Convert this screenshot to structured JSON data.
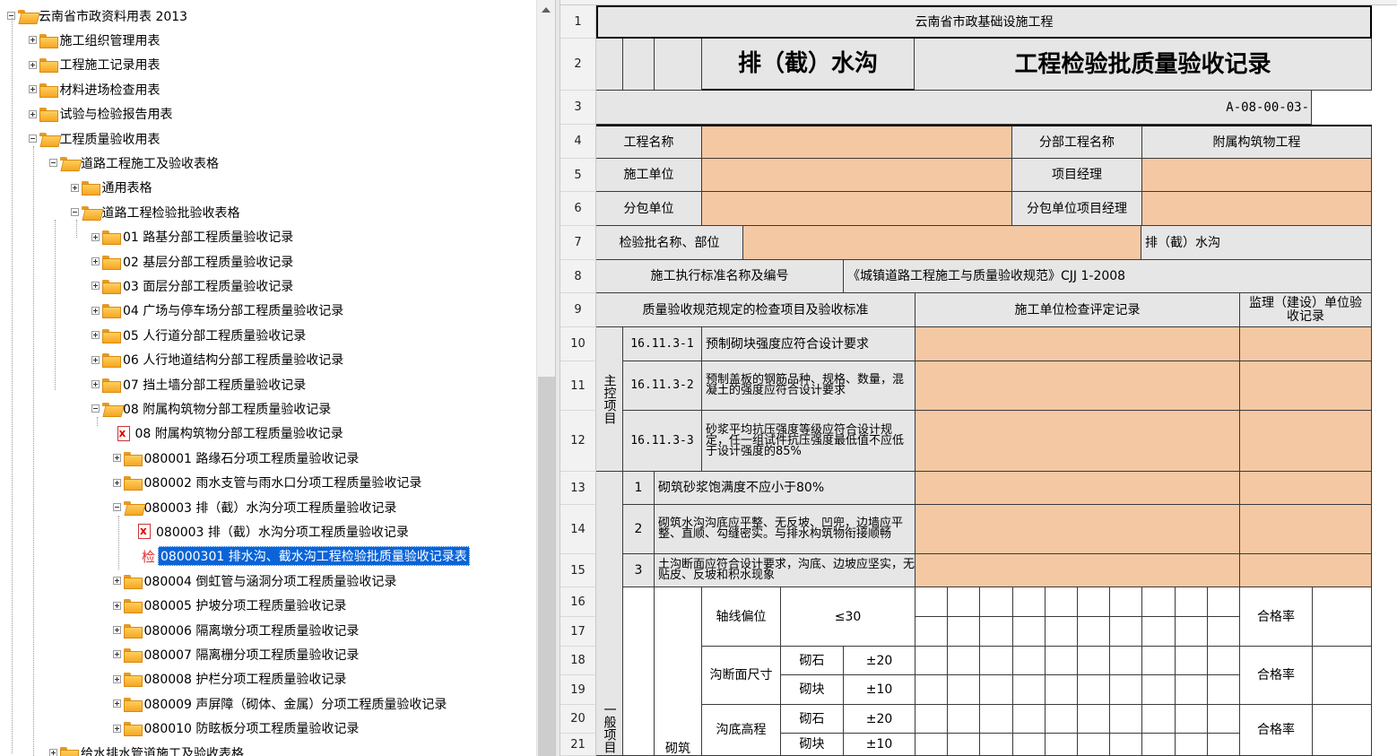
{
  "tree": {
    "items": [
      {
        "label": "云南省市政资料用表 2013",
        "level": 0,
        "node": "open"
      },
      {
        "label": "施工组织管理用表",
        "level": 1,
        "node": "closed"
      },
      {
        "label": "工程施工记录用表",
        "level": 1,
        "node": "closed"
      },
      {
        "label": "材料进场检查用表",
        "level": 1,
        "node": "closed"
      },
      {
        "label": "试验与检验报告用表",
        "level": 1,
        "node": "closed"
      },
      {
        "label": "工程质量验收用表",
        "level": 1,
        "node": "open"
      },
      {
        "label": "道路工程施工及验收表格",
        "level": 2,
        "node": "open"
      },
      {
        "label": "通用表格",
        "level": 3,
        "node": "closed"
      },
      {
        "label": "道路工程检验批验收表格",
        "level": 3,
        "node": "open"
      },
      {
        "label": "01 路基分部工程质量验收记录",
        "level": 4,
        "node": "closed"
      },
      {
        "label": "02 基层分部工程质量验收记录",
        "level": 4,
        "node": "closed"
      },
      {
        "label": "03 面层分部工程质量验收记录",
        "level": 4,
        "node": "closed"
      },
      {
        "label": "04 广场与停车场分部工程质量验收记录",
        "level": 4,
        "node": "closed"
      },
      {
        "label": "05 人行道分部工程质量验收记录",
        "level": 4,
        "node": "closed"
      },
      {
        "label": "06 人行地道结构分部工程质量验收记录",
        "level": 4,
        "node": "closed"
      },
      {
        "label": "07 挡土墙分部工程质量验收记录",
        "level": 4,
        "node": "closed"
      },
      {
        "label": "08 附属构筑物分部工程质量验收记录",
        "level": 4,
        "node": "open"
      },
      {
        "label": "08 附属构筑物分部工程质量验收记录",
        "level": 5,
        "node": "pdf"
      },
      {
        "label": "080001 路缘石分项工程质量验收记录",
        "level": 5,
        "node": "closed"
      },
      {
        "label": "080002 雨水支管与雨水口分项工程质量验收记录",
        "level": 5,
        "node": "closed"
      },
      {
        "label": "080003 排（截）水沟分项工程质量验收记录",
        "level": 5,
        "node": "open"
      },
      {
        "label": "080003 排（截）水沟分项工程质量验收记录",
        "level": 6,
        "node": "pdf"
      },
      {
        "label": "08000301 排水沟、截水沟工程检验批质量验收记录表",
        "level": 6,
        "node": "sheet",
        "selected": true,
        "icon_text": "检"
      },
      {
        "label": "080004 倒虹管与涵洞分项工程质量验收记录",
        "level": 5,
        "node": "closed"
      },
      {
        "label": "080005 护坡分项工程质量验收记录",
        "level": 5,
        "node": "closed"
      },
      {
        "label": "080006 隔离墩分项工程质量验收记录",
        "level": 5,
        "node": "closed"
      },
      {
        "label": "080007 隔离栅分项工程质量验收记录",
        "level": 5,
        "node": "closed"
      },
      {
        "label": "080008 护栏分项工程质量验收记录",
        "level": 5,
        "node": "closed"
      },
      {
        "label": "080009 声屏障（砌体、金属）分项工程质量验收记录",
        "level": 5,
        "node": "closed"
      },
      {
        "label": "080010 防眩板分项工程质量验收记录",
        "level": 5,
        "node": "closed"
      },
      {
        "label": "给水排水管道施工及验收表格",
        "level": 2,
        "node": "closed"
      }
    ]
  },
  "sheet": {
    "row_numbers": [
      "1",
      "2",
      "3",
      "4",
      "5",
      "6",
      "7",
      "8",
      "9",
      "10",
      "11",
      "12",
      "13",
      "14",
      "15",
      "16",
      "17",
      "18",
      "19",
      "20",
      "21"
    ],
    "title_top": "云南省市政基础设施工程",
    "title_left": "排（截）水沟",
    "title_right": "工程检验批质量验收记录",
    "form_code": "A-08-00-03-",
    "project_name_label": "工程名称",
    "sub_project_label": "分部工程名称",
    "sub_project_value": "附属构筑物工程",
    "contractor_label": "施工单位",
    "project_manager_label": "项目经理",
    "subcontractor_label": "分包单位",
    "sub_pm_label": "分包单位项目经理",
    "batch_label": "检验批名称、部位",
    "batch_value": "排（截）水沟",
    "standard_label": "施工执行标准名称及编号",
    "standard_value": "《城镇道路工程施工与质量验收规范》CJJ 1-2008",
    "header_items": "质量验收规范规定的检查项目及验收标准",
    "header_contractor": "施工单位检查评定记录",
    "header_supervisor": "监理（建设）单位验收记录",
    "main_items_label": "主控项目",
    "general_items_label": "一般项目",
    "main_items": [
      {
        "code": "16.11.3-1",
        "text": "预制砌块强度应符合设计要求"
      },
      {
        "code": "16.11.3-2",
        "text": "预制盖板的钢筋品种、规格、数量，混凝土的强度应符合设计要求"
      },
      {
        "code": "16.11.3-3",
        "text": "砂浆平均抗压强度等级应符合设计规定，任一组试件抗压强度最低值不应低于设计强度的85%"
      }
    ],
    "general_items": [
      {
        "no": "1",
        "text": "砌筑砂浆饱满度不应小于80%"
      },
      {
        "no": "2",
        "text": "砌筑水沟沟底应平整、无反坡、凹兜，边墙应平整、直顺、勾缝密实。与排水构筑物衔接顺畅"
      },
      {
        "no": "3",
        "text": "土沟断面应符合设计要求，沟底、边坡应坚实，无贴皮、反坡和积水现象"
      }
    ],
    "masonry_label": "砌筑",
    "tolerances": {
      "axis_offset": "轴线偏位",
      "axis_value": "≤30",
      "section_size": "沟断面尺寸",
      "bottom_elev": "沟底高程",
      "stone": "砌石",
      "block": "砌块",
      "stone_tol": "±20",
      "block_tol": "±10",
      "pass_rate": "合格率"
    }
  }
}
